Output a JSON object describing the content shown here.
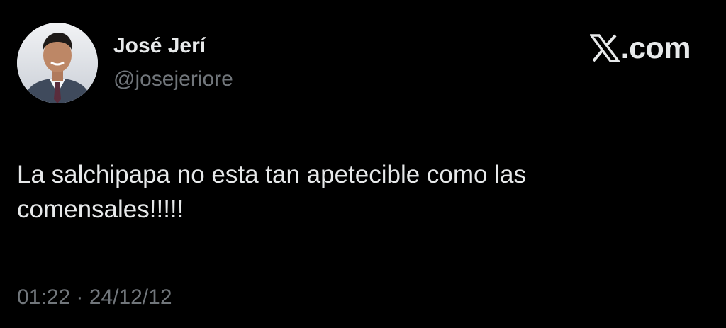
{
  "tweet": {
    "author": {
      "display_name": "José Jerí",
      "handle": "@josejeriore"
    },
    "brand": {
      "logo_icon": "x-logo-icon",
      "text": ".com"
    },
    "text": "La salchipapa no esta tan apetecible como las comensales!!!!!",
    "timestamp": "01:22 · 24/12/12"
  },
  "colors": {
    "background": "#000000",
    "primary_text": "#e7e9ea",
    "secondary_text": "#71767b"
  }
}
